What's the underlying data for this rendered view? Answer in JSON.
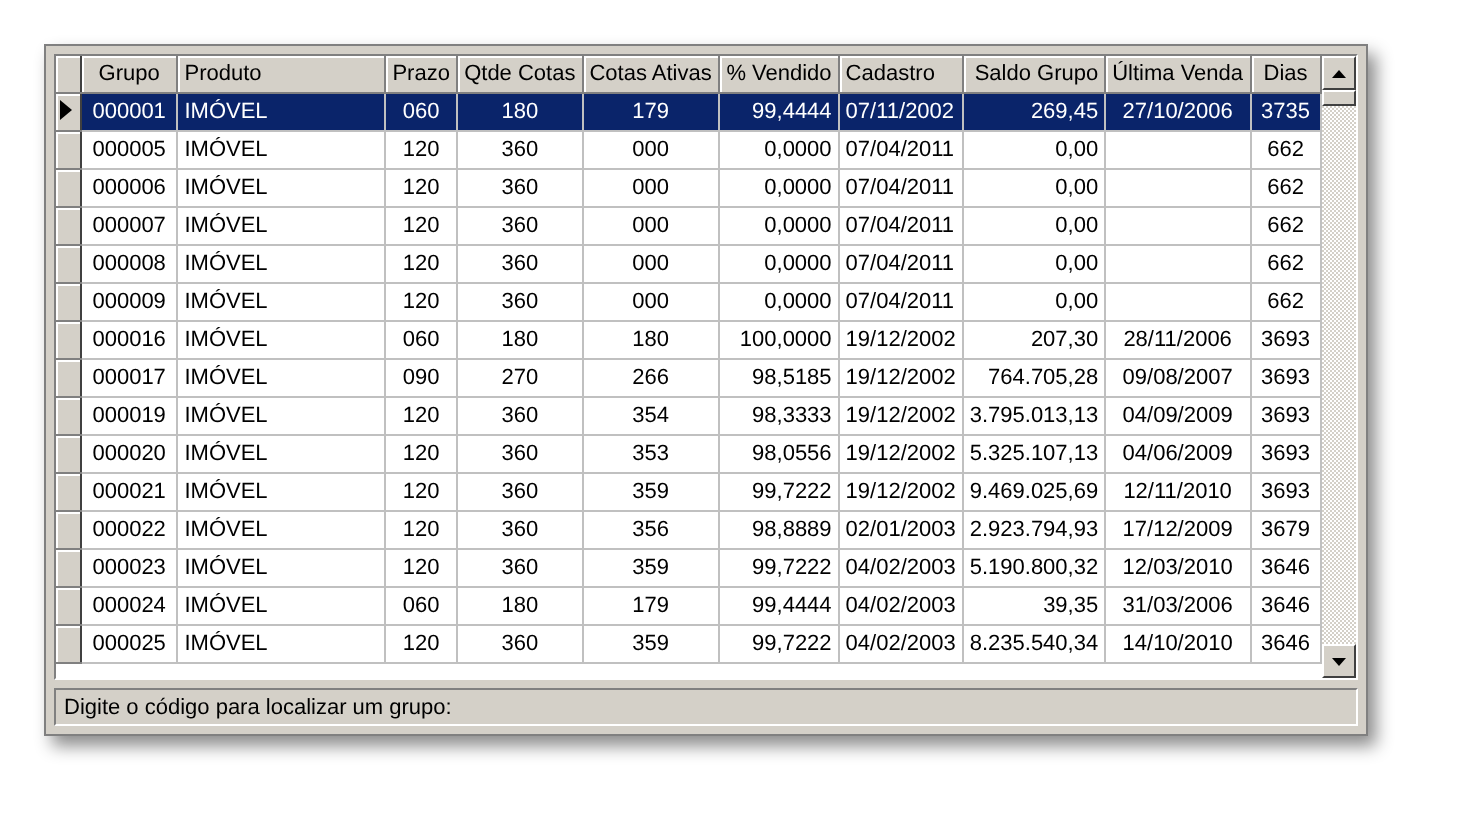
{
  "table": {
    "columns": [
      "Grupo",
      "Produto",
      "Prazo",
      "Qtde Cotas",
      "Cotas Ativas",
      "% Vendido",
      "Cadastro",
      "Saldo Grupo",
      "Última Venda",
      "Dias"
    ],
    "rows": [
      {
        "selected": true,
        "cells": [
          "000001",
          "IMÓVEL",
          "060",
          "180",
          "179",
          "99,4444",
          "07/11/2002",
          "269,45",
          "27/10/2006",
          "3735"
        ]
      },
      {
        "selected": false,
        "cells": [
          "000005",
          "IMÓVEL",
          "120",
          "360",
          "000",
          "0,0000",
          "07/04/2011",
          "0,00",
          "",
          "662"
        ]
      },
      {
        "selected": false,
        "cells": [
          "000006",
          "IMÓVEL",
          "120",
          "360",
          "000",
          "0,0000",
          "07/04/2011",
          "0,00",
          "",
          "662"
        ]
      },
      {
        "selected": false,
        "cells": [
          "000007",
          "IMÓVEL",
          "120",
          "360",
          "000",
          "0,0000",
          "07/04/2011",
          "0,00",
          "",
          "662"
        ]
      },
      {
        "selected": false,
        "cells": [
          "000008",
          "IMÓVEL",
          "120",
          "360",
          "000",
          "0,0000",
          "07/04/2011",
          "0,00",
          "",
          "662"
        ]
      },
      {
        "selected": false,
        "cells": [
          "000009",
          "IMÓVEL",
          "120",
          "360",
          "000",
          "0,0000",
          "07/04/2011",
          "0,00",
          "",
          "662"
        ]
      },
      {
        "selected": false,
        "cells": [
          "000016",
          "IMÓVEL",
          "060",
          "180",
          "180",
          "100,0000",
          "19/12/2002",
          "207,30",
          "28/11/2006",
          "3693"
        ]
      },
      {
        "selected": false,
        "cells": [
          "000017",
          "IMÓVEL",
          "090",
          "270",
          "266",
          "98,5185",
          "19/12/2002",
          "764.705,28",
          "09/08/2007",
          "3693"
        ]
      },
      {
        "selected": false,
        "cells": [
          "000019",
          "IMÓVEL",
          "120",
          "360",
          "354",
          "98,3333",
          "19/12/2002",
          "3.795.013,13",
          "04/09/2009",
          "3693"
        ]
      },
      {
        "selected": false,
        "cells": [
          "000020",
          "IMÓVEL",
          "120",
          "360",
          "353",
          "98,0556",
          "19/12/2002",
          "5.325.107,13",
          "04/06/2009",
          "3693"
        ]
      },
      {
        "selected": false,
        "cells": [
          "000021",
          "IMÓVEL",
          "120",
          "360",
          "359",
          "99,7222",
          "19/12/2002",
          "9.469.025,69",
          "12/11/2010",
          "3693"
        ]
      },
      {
        "selected": false,
        "cells": [
          "000022",
          "IMÓVEL",
          "120",
          "360",
          "356",
          "98,8889",
          "02/01/2003",
          "2.923.794,93",
          "17/12/2009",
          "3679"
        ]
      },
      {
        "selected": false,
        "cells": [
          "000023",
          "IMÓVEL",
          "120",
          "360",
          "359",
          "99,7222",
          "04/02/2003",
          "5.190.800,32",
          "12/03/2010",
          "3646"
        ]
      },
      {
        "selected": false,
        "cells": [
          "000024",
          "IMÓVEL",
          "060",
          "180",
          "179",
          "99,4444",
          "04/02/2003",
          "39,35",
          "31/03/2006",
          "3646"
        ]
      },
      {
        "selected": false,
        "cells": [
          "000025",
          "IMÓVEL",
          "120",
          "360",
          "359",
          "99,7222",
          "04/02/2003",
          "8.235.540,34",
          "14/10/2010",
          "3646"
        ]
      }
    ]
  },
  "status_bar": {
    "text": "Digite o código para localizar um grupo:"
  }
}
